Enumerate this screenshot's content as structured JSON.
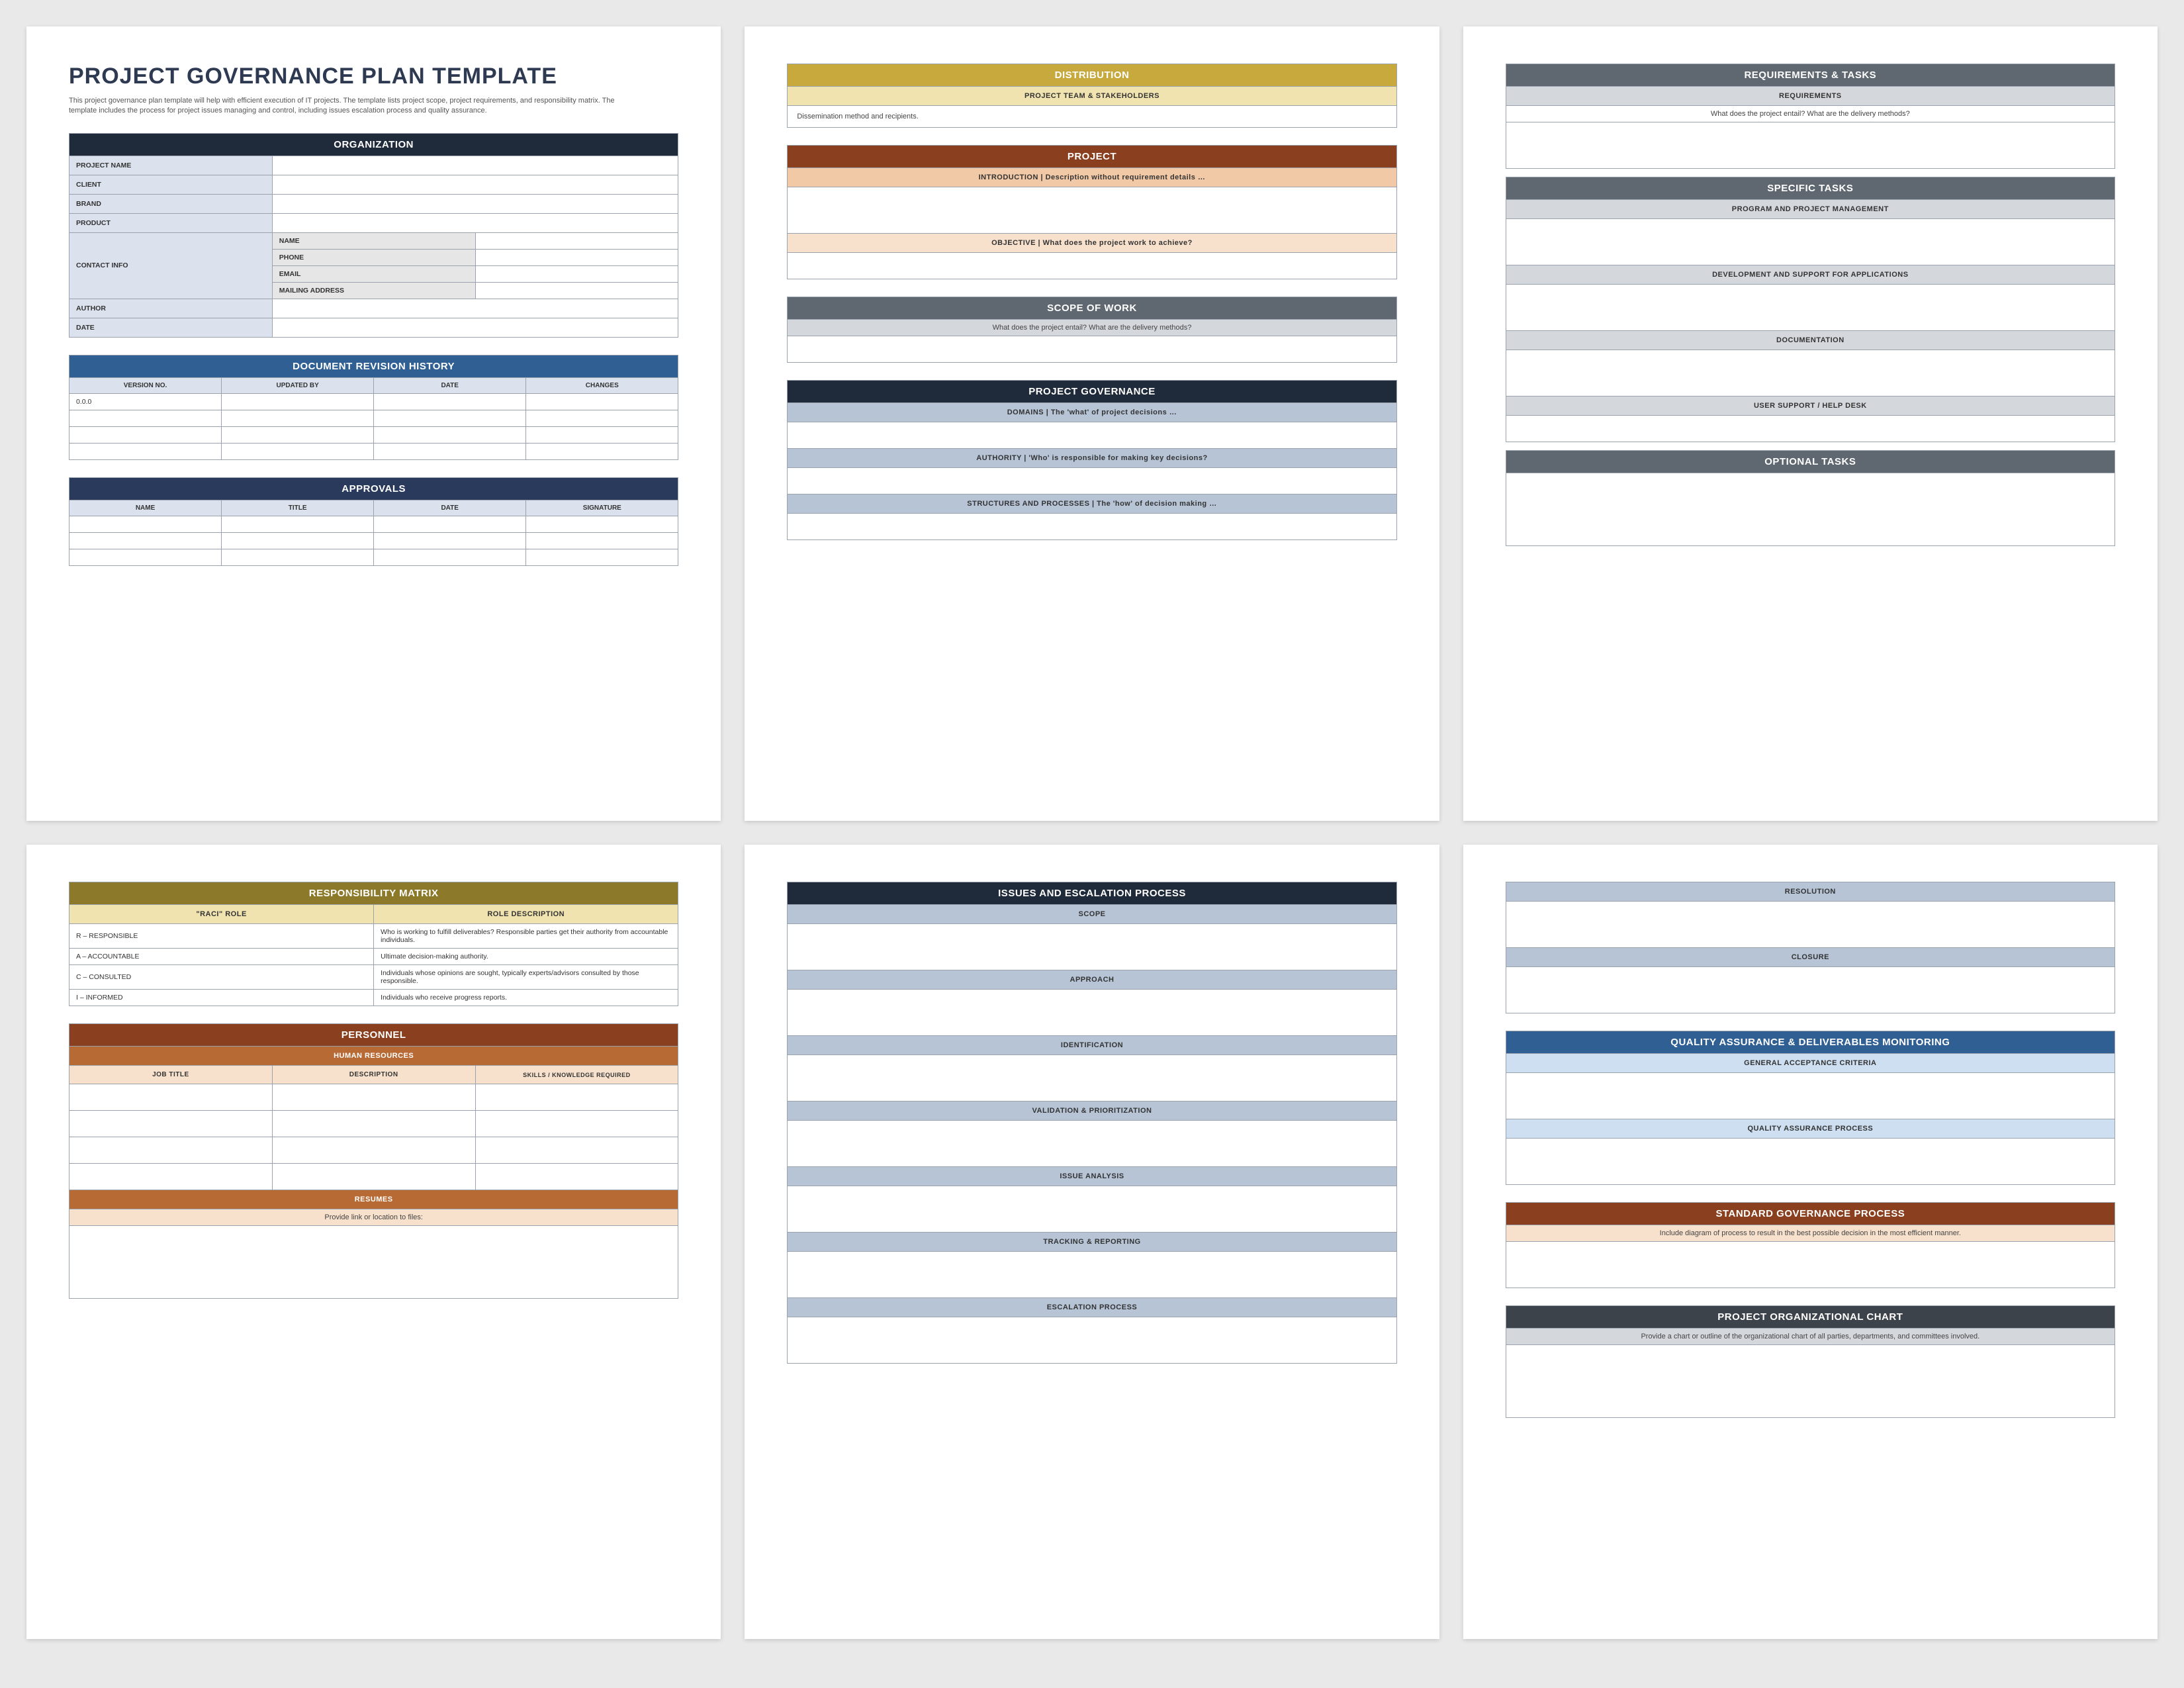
{
  "doc": {
    "title": "PROJECT GOVERNANCE PLAN TEMPLATE",
    "intro": "This project governance plan template will help with efficient execution of IT projects. The template lists project scope, project requirements, and responsibility matrix. The template includes the process for project issues managing and control, including issues escalation process and quality assurance."
  },
  "page1": {
    "org_header": "ORGANIZATION",
    "rows": {
      "project_name": "PROJECT NAME",
      "client": "CLIENT",
      "brand": "BRAND",
      "product": "PRODUCT",
      "contact_info": "CONTACT INFO",
      "contact_sub": {
        "name": "NAME",
        "phone": "PHONE",
        "email": "EMAIL",
        "mailing": "MAILING ADDRESS"
      },
      "author": "AUTHOR",
      "date": "DATE"
    },
    "rev_header": "DOCUMENT REVISION HISTORY",
    "rev_cols": [
      "VERSION NO.",
      "UPDATED BY",
      "DATE",
      "CHANGES"
    ],
    "rev_first": "0.0.0",
    "approvals_header": "APPROVALS",
    "appr_cols": [
      "NAME",
      "TITLE",
      "DATE",
      "SIGNATURE"
    ]
  },
  "page2": {
    "dist": "DISTRIBUTION",
    "dist_sub": "PROJECT TEAM & STAKEHOLDERS",
    "dist_note": "Dissemination method and recipients.",
    "project": "PROJECT",
    "intro_row": "INTRODUCTION   |   Description without requirement details …",
    "objective_row": "OBJECTIVE   |   What does the project work to achieve?",
    "scope": "SCOPE OF WORK",
    "scope_note": "What does the project entail? What are the delivery methods?",
    "gov": "PROJECT GOVERNANCE",
    "gov_domains": "DOMAINS   |   The 'what' of project decisions …",
    "gov_authority": "AUTHORITY   |   'Who' is responsible for making key decisions?",
    "gov_struct": "STRUCTURES AND PROCESSES   |   The 'how' of decision making …"
  },
  "page3": {
    "req_tasks": "REQUIREMENTS & TASKS",
    "req": "REQUIREMENTS",
    "req_note": "What does the project entail? What are the delivery methods?",
    "spec_tasks": "SPECIFIC TASKS",
    "t1": "PROGRAM AND PROJECT MANAGEMENT",
    "t2": "DEVELOPMENT AND SUPPORT FOR APPLICATIONS",
    "t3": "DOCUMENTATION",
    "t4": "USER SUPPORT / HELP DESK",
    "opt": "OPTIONAL TASKS"
  },
  "page4": {
    "resp_matrix": "RESPONSIBILITY MATRIX",
    "cols": [
      "\"RACI\" ROLE",
      "ROLE DESCRIPTION"
    ],
    "rows": [
      {
        "role": "R – RESPONSIBLE",
        "desc": "Who is working to fulfill deliverables? Responsible parties get their authority from accountable individuals."
      },
      {
        "role": "A – ACCOUNTABLE",
        "desc": "Ultimate decision-making authority."
      },
      {
        "role": "C – CONSULTED",
        "desc": "Individuals whose opinions are sought, typically experts/advisors consulted by those responsible."
      },
      {
        "role": "I – INFORMED",
        "desc": "Individuals who receive progress reports."
      }
    ],
    "personnel": "PERSONNEL",
    "hr": "HUMAN RESOURCES",
    "hr_cols": [
      "JOB TITLE",
      "DESCRIPTION",
      "SKILLS / KNOWLEDGE REQUIRED"
    ],
    "resumes": "RESUMES",
    "resumes_note": "Provide link or location to files:"
  },
  "page5": {
    "header": "ISSUES AND ESCALATION PROCESS",
    "rows": [
      "SCOPE",
      "APPROACH",
      "IDENTIFICATION",
      "VALIDATION & PRIORITIZATION",
      "ISSUE ANALYSIS",
      "TRACKING & REPORTING",
      "ESCALATION PROCESS"
    ]
  },
  "page6": {
    "resolution": "RESOLUTION",
    "closure": "CLOSURE",
    "qa_header": "QUALITY ASSURANCE & DELIVERABLES MONITORING",
    "qa_r1": "GENERAL ACCEPTANCE CRITERIA",
    "qa_r2": "QUALITY ASSURANCE PROCESS",
    "std_header": "STANDARD GOVERNANCE PROCESS",
    "std_note": "Include diagram of process to result in the best possible decision in the most efficient manner.",
    "org_header": "PROJECT ORGANIZATIONAL CHART",
    "org_note": "Provide a chart or outline of the organizational chart of all parties, departments, and committees involved."
  }
}
